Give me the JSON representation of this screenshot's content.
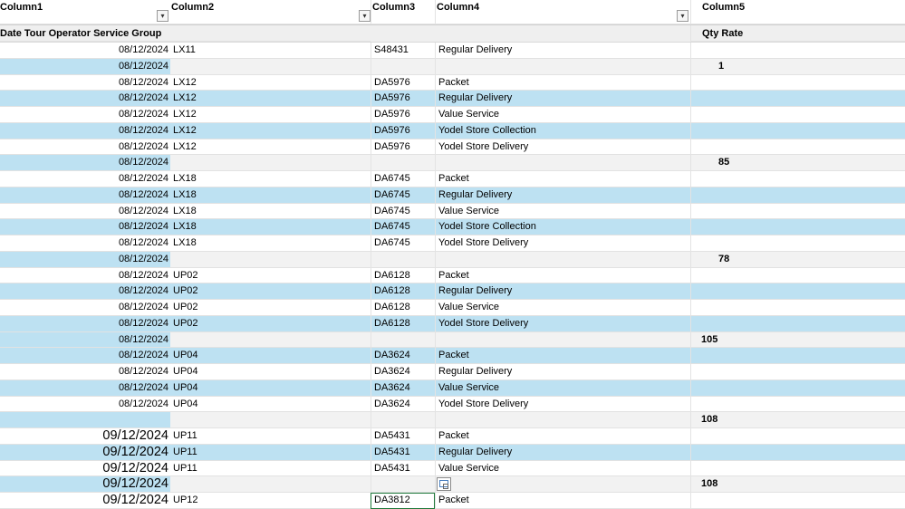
{
  "headers": [
    "Column1",
    "Column2",
    "Column3",
    "Column4",
    "Column5"
  ],
  "subheader": {
    "left": "Date Tour Operator Service Group",
    "right": "Qty Rate"
  },
  "rows": [
    {
      "type": "white",
      "c1": "08/12/2024",
      "c2": "LX11",
      "c3": "S48431",
      "c4": "Regular Delivery",
      "c5": ""
    },
    {
      "type": "total",
      "c1": "08/12/2024",
      "c2": "",
      "c3": "",
      "c4": "",
      "c5": "1",
      "center": true
    },
    {
      "type": "white",
      "c1": "08/12/2024",
      "c2": "LX12",
      "c3": "DA5976",
      "c4": "Packet",
      "c5": ""
    },
    {
      "type": "band",
      "c1": "08/12/2024",
      "c2": "LX12",
      "c3": "DA5976",
      "c4": "Regular Delivery",
      "c5": ""
    },
    {
      "type": "white",
      "c1": "08/12/2024",
      "c2": "LX12",
      "c3": "DA5976",
      "c4": "Value Service",
      "c5": ""
    },
    {
      "type": "band",
      "c1": "08/12/2024",
      "c2": "LX12",
      "c3": "DA5976",
      "c4": "Yodel Store Collection",
      "c5": ""
    },
    {
      "type": "white",
      "c1": "08/12/2024",
      "c2": "LX12",
      "c3": "DA5976",
      "c4": "Yodel Store Delivery",
      "c5": ""
    },
    {
      "type": "total",
      "c1": "08/12/2024",
      "c2": "",
      "c3": "",
      "c4": "",
      "c5": "85",
      "center": true
    },
    {
      "type": "white",
      "c1": "08/12/2024",
      "c2": "LX18",
      "c3": "DA6745",
      "c4": "Packet",
      "c5": ""
    },
    {
      "type": "band",
      "c1": "08/12/2024",
      "c2": "LX18",
      "c3": "DA6745",
      "c4": "Regular Delivery",
      "c5": ""
    },
    {
      "type": "white",
      "c1": "08/12/2024",
      "c2": "LX18",
      "c3": "DA6745",
      "c4": "Value Service",
      "c5": ""
    },
    {
      "type": "band",
      "c1": "08/12/2024",
      "c2": "LX18",
      "c3": "DA6745",
      "c4": "Yodel Store Collection",
      "c5": ""
    },
    {
      "type": "white",
      "c1": "08/12/2024",
      "c2": "LX18",
      "c3": "DA6745",
      "c4": "Yodel Store Delivery",
      "c5": ""
    },
    {
      "type": "total",
      "c1": "08/12/2024",
      "c2": "",
      "c3": "",
      "c4": "",
      "c5": "78",
      "center": true
    },
    {
      "type": "white",
      "c1": "08/12/2024",
      "c2": "UP02",
      "c3": "DA6128",
      "c4": "Packet",
      "c5": ""
    },
    {
      "type": "band",
      "c1": "08/12/2024",
      "c2": "UP02",
      "c3": "DA6128",
      "c4": "Regular Delivery",
      "c5": ""
    },
    {
      "type": "white",
      "c1": "08/12/2024",
      "c2": "UP02",
      "c3": "DA6128",
      "c4": "Value Service",
      "c5": ""
    },
    {
      "type": "band",
      "c1": "08/12/2024",
      "c2": "UP02",
      "c3": "DA6128",
      "c4": "Yodel Store Delivery",
      "c5": ""
    },
    {
      "type": "total",
      "c1": "08/12/2024",
      "c2": "",
      "c3": "",
      "c4": "",
      "c5": "105",
      "center": false
    },
    {
      "type": "band",
      "c1": "08/12/2024",
      "c2": "UP04",
      "c3": "DA3624",
      "c4": "Packet",
      "c5": ""
    },
    {
      "type": "white",
      "c1": "08/12/2024",
      "c2": "UP04",
      "c3": "DA3624",
      "c4": "Regular Delivery",
      "c5": ""
    },
    {
      "type": "band",
      "c1": "08/12/2024",
      "c2": "UP04",
      "c3": "DA3624",
      "c4": "Value Service",
      "c5": ""
    },
    {
      "type": "white",
      "c1": "08/12/2024",
      "c2": "UP04",
      "c3": "DA3624",
      "c4": "Yodel Store Delivery",
      "c5": ""
    },
    {
      "type": "total",
      "c1": "",
      "c2": "",
      "c3": "",
      "c4": "",
      "c5": "108",
      "center": false
    },
    {
      "type": "white",
      "c1": "09/12/2024",
      "c2": "UP11",
      "c3": "DA5431",
      "c4": "Packet",
      "c5": "",
      "big": true
    },
    {
      "type": "band",
      "c1": "09/12/2024",
      "c2": "UP11",
      "c3": "DA5431",
      "c4": "Regular Delivery",
      "c5": "",
      "big": true
    },
    {
      "type": "white",
      "c1": "09/12/2024",
      "c2": "UP11",
      "c3": "DA5431",
      "c4": "Value Service",
      "c5": "",
      "big": true
    },
    {
      "type": "total",
      "c1": "09/12/2024",
      "c2": "",
      "c3": "",
      "c4": "",
      "c5": "108",
      "center": false,
      "big": true,
      "icon": true
    },
    {
      "type": "white",
      "c1": "09/12/2024",
      "c2": "UP12",
      "c3": "DA3812",
      "c4": "Packet",
      "c5": "",
      "big": true,
      "sel": true
    }
  ],
  "icons": {
    "filter": "filter-dropdown-icon",
    "quick_analysis": "quick-analysis-icon"
  },
  "colors": {
    "band": "#bde1f2",
    "total_bg": "#f2f2f2",
    "selection": "#1f7a3b"
  }
}
